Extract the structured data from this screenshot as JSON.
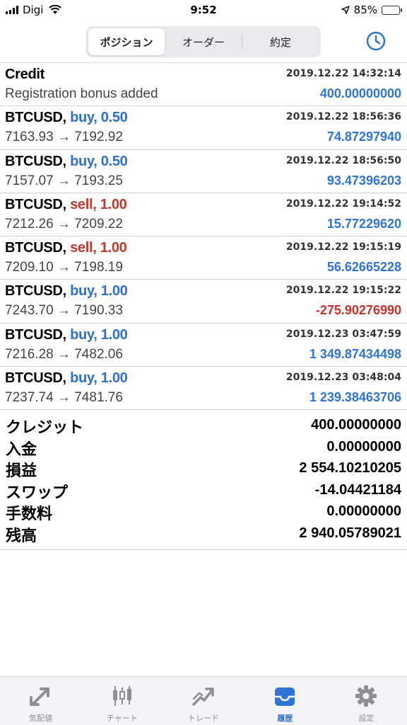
{
  "status_bar": {
    "carrier": "Digi",
    "time": "9:52",
    "battery": "85%",
    "battery_level": 0.85
  },
  "tabs": [
    {
      "label": "ポジション",
      "active": true
    },
    {
      "label": "オーダー",
      "active": false
    },
    {
      "label": "約定",
      "active": false
    }
  ],
  "history_icon": "clock-icon",
  "deals": [
    {
      "symbol": "Credit",
      "side": "",
      "volume": "",
      "date": "2019.12.22 14:32:14",
      "prices": "Registration bonus added",
      "amount": "400.00000000",
      "negative": false
    },
    {
      "symbol": "BTCUSD,",
      "side": "buy, 0.50",
      "side_type": "buy",
      "date": "2019.12.22 18:56:36",
      "prices": "7163.93 → 7192.92",
      "amount": "74.87297940",
      "negative": false
    },
    {
      "symbol": "BTCUSD,",
      "side": "buy, 0.50",
      "side_type": "buy",
      "date": "2019.12.22 18:56:50",
      "prices": "7157.07 → 7193.25",
      "amount": "93.47396203",
      "negative": false
    },
    {
      "symbol": "BTCUSD,",
      "side": "sell, 1.00",
      "side_type": "sell",
      "date": "2019.12.22 19:14:52",
      "prices": "7212.26 → 7209.22",
      "amount": "15.77229620",
      "negative": false
    },
    {
      "symbol": "BTCUSD,",
      "side": "sell, 1.00",
      "side_type": "sell",
      "date": "2019.12.22 19:15:19",
      "prices": "7209.10 → 7198.19",
      "amount": "56.62665228",
      "negative": false
    },
    {
      "symbol": "BTCUSD,",
      "side": "buy, 1.00",
      "side_type": "buy",
      "date": "2019.12.22 19:15:22",
      "prices": "7243.70 → 7190.33",
      "amount": "-275.90276990",
      "negative": true
    },
    {
      "symbol": "BTCUSD,",
      "side": "buy, 1.00",
      "side_type": "buy",
      "date": "2019.12.23 03:47:59",
      "prices": "7216.28 → 7482.06",
      "amount": "1 349.87434498",
      "negative": false
    },
    {
      "symbol": "BTCUSD,",
      "side": "buy, 1.00",
      "side_type": "buy",
      "date": "2019.12.23 03:48:04",
      "prices": "7237.74 → 7481.76",
      "amount": "1 239.38463706",
      "negative": false
    }
  ],
  "summary": [
    {
      "label": "クレジット",
      "value": "400.00000000"
    },
    {
      "label": "入金",
      "value": "0.00000000"
    },
    {
      "label": "損益",
      "value": "2 554.10210205"
    },
    {
      "label": "スワップ",
      "value": "-14.04421184"
    },
    {
      "label": "手数料",
      "value": "0.00000000"
    },
    {
      "label": "残高",
      "value": "2 940.05789021"
    }
  ],
  "tabbar": [
    {
      "label": "気配値",
      "icon": "quotes-arrows-icon",
      "active": false
    },
    {
      "label": "チャート",
      "icon": "candlestick-chart-icon",
      "active": false
    },
    {
      "label": "トレード",
      "icon": "trade-trend-icon",
      "active": false
    },
    {
      "label": "履歴",
      "icon": "history-tray-icon",
      "active": true
    },
    {
      "label": "設定",
      "icon": "gear-icon",
      "active": false
    }
  ],
  "colors": {
    "accent": "#2f74d6",
    "buy": "#2f6fd1",
    "sell": "#c0392b",
    "negative": "#c9302c",
    "inactive_icon": "#8e8e93"
  }
}
